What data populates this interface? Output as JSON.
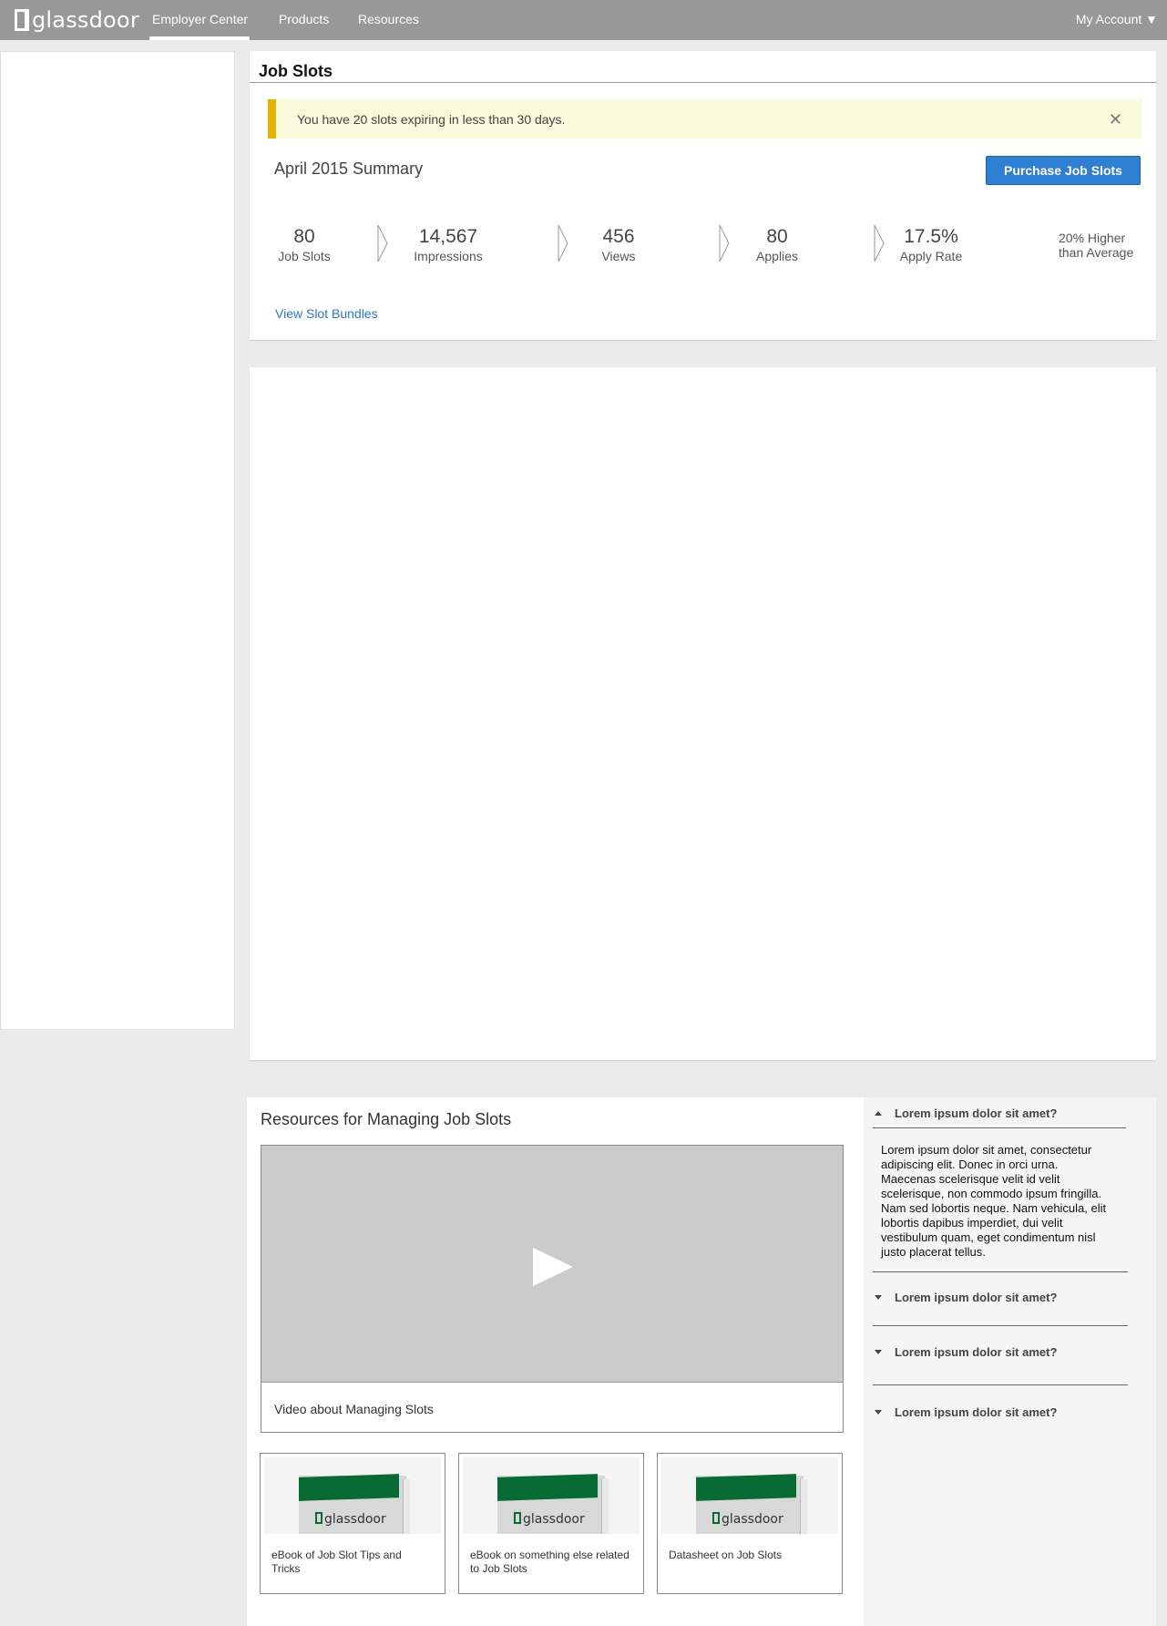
{
  "nav": {
    "logo_text": "glassdoor",
    "links": [
      "Employer Center",
      "Products",
      "Resources"
    ],
    "account": "My Account ▼"
  },
  "job_slots": {
    "title": "Job Slots",
    "alert": "You have 20 slots expiring in less than 30 days.",
    "close_glyph": "✕",
    "summary_title": "April 2015 Summary",
    "purchase_label": "Purchase Job Slots",
    "stats": [
      {
        "value": "80",
        "label": "Job Slots"
      },
      {
        "value": "14,567",
        "label": "Impressions"
      },
      {
        "value": "456",
        "label": "Views"
      },
      {
        "value": "80",
        "label": "Applies"
      },
      {
        "value": "17.5%",
        "label": "Apply Rate"
      }
    ],
    "comparison_line1": "20% Higher",
    "comparison_line2": "than Average",
    "view_bundles": "View Slot Bundles"
  },
  "resources": {
    "title": "Resources for Managing Job Slots",
    "video_caption": "Video about Managing Slots",
    "ebooks": [
      {
        "brand": "glassdoor",
        "label": "eBook of Job Slot Tips and Tricks"
      },
      {
        "brand": "glassdoor",
        "label": "eBook on something else related to Job Slots"
      },
      {
        "brand": "glassdoor",
        "label": "Datasheet on Job Slots"
      }
    ]
  },
  "faq": {
    "items": [
      {
        "question": "Lorem ipsum dolor sit amet?",
        "expanded": true,
        "answer": "Lorem ipsum dolor sit amet, consectetur adipiscing elit. Donec in orci urna. Maecenas scelerisque velit id velit scelerisque, non commodo ipsum fringilla. Nam sed lobortis neque. Nam vehicula, elit lobortis dapibus imperdiet, dui velit vestibulum quam, eget condimentum nisl justo placerat tellus."
      },
      {
        "question": "Lorem ipsum dolor sit amet?",
        "expanded": false
      },
      {
        "question": "Lorem ipsum dolor sit amet?",
        "expanded": false
      },
      {
        "question": "Lorem ipsum dolor sit amet?",
        "expanded": false
      }
    ]
  },
  "colors": {
    "nav_bg": "#989898",
    "alert_bar": "#e0b400",
    "button": "#2f7fd3",
    "link": "#2b78c5",
    "book_green": "#086b34"
  }
}
